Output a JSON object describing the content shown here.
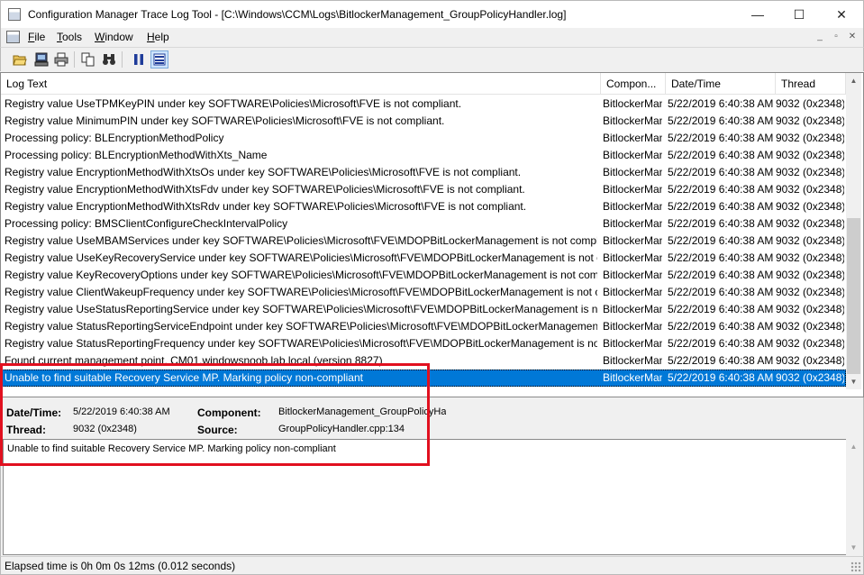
{
  "window": {
    "title": "Configuration Manager Trace Log Tool - [C:\\Windows\\CCM\\Logs\\BitlockerManagement_GroupPolicyHandler.log]",
    "controls": {
      "minimize": "—",
      "maximize": "☐",
      "close": "✕"
    }
  },
  "menu": {
    "items": [
      {
        "label": "File",
        "accel": "F",
        "rest": "ile"
      },
      {
        "label": "Tools",
        "accel": "T",
        "rest": "ools"
      },
      {
        "label": "Window",
        "accel": "W",
        "rest": "indow"
      },
      {
        "label": "Help",
        "accel": "H",
        "rest": "elp"
      }
    ],
    "mdi": {
      "minimize": "_",
      "restore": "▫",
      "close": "✕"
    }
  },
  "toolbar": {
    "buttons": [
      "open-icon",
      "open-remote-icon",
      "print-icon",
      "copy-icon",
      "find-icon",
      "pause-icon",
      "highlight-icon"
    ]
  },
  "log": {
    "columns": [
      "Log Text",
      "Compon...",
      "Date/Time",
      "Thread"
    ],
    "rows": [
      {
        "text": "Registry value UseTPMKeyPIN under key SOFTWARE\\Policies\\Microsoft\\FVE is not compliant.",
        "component": "BitlockerMan",
        "datetime": "5/22/2019 6:40:38 AM",
        "thread": "9032 (0x2348)"
      },
      {
        "text": "Registry value MinimumPIN under key SOFTWARE\\Policies\\Microsoft\\FVE is not compliant.",
        "component": "BitlockerMan",
        "datetime": "5/22/2019 6:40:38 AM",
        "thread": "9032 (0x2348)"
      },
      {
        "text": "Processing policy: BLEncryptionMethodPolicy",
        "component": "BitlockerMan",
        "datetime": "5/22/2019 6:40:38 AM",
        "thread": "9032 (0x2348)"
      },
      {
        "text": "Processing policy: BLEncryptionMethodWithXts_Name",
        "component": "BitlockerMan",
        "datetime": "5/22/2019 6:40:38 AM",
        "thread": "9032 (0x2348)"
      },
      {
        "text": "Registry value EncryptionMethodWithXtsOs under key SOFTWARE\\Policies\\Microsoft\\FVE is not compliant.",
        "component": "BitlockerMan",
        "datetime": "5/22/2019 6:40:38 AM",
        "thread": "9032 (0x2348)"
      },
      {
        "text": "Registry value EncryptionMethodWithXtsFdv under key SOFTWARE\\Policies\\Microsoft\\FVE is not compliant.",
        "component": "BitlockerMan",
        "datetime": "5/22/2019 6:40:38 AM",
        "thread": "9032 (0x2348)"
      },
      {
        "text": "Registry value EncryptionMethodWithXtsRdv under key SOFTWARE\\Policies\\Microsoft\\FVE is not compliant.",
        "component": "BitlockerMan",
        "datetime": "5/22/2019 6:40:38 AM",
        "thread": "9032 (0x2348)"
      },
      {
        "text": "Processing policy: BMSClientConfigureCheckIntervalPolicy",
        "component": "BitlockerMan",
        "datetime": "5/22/2019 6:40:38 AM",
        "thread": "9032 (0x2348)"
      },
      {
        "text": "Registry value UseMBAMServices under key SOFTWARE\\Policies\\Microsoft\\FVE\\MDOPBitLockerManagement is not compli...",
        "component": "BitlockerMan",
        "datetime": "5/22/2019 6:40:38 AM",
        "thread": "9032 (0x2348)"
      },
      {
        "text": "Registry value UseKeyRecoveryService under key SOFTWARE\\Policies\\Microsoft\\FVE\\MDOPBitLockerManagement is not c...",
        "component": "BitlockerMan",
        "datetime": "5/22/2019 6:40:38 AM",
        "thread": "9032 (0x2348)"
      },
      {
        "text": "Registry value KeyRecoveryOptions under key SOFTWARE\\Policies\\Microsoft\\FVE\\MDOPBitLockerManagement is not com...",
        "component": "BitlockerMan",
        "datetime": "5/22/2019 6:40:38 AM",
        "thread": "9032 (0x2348)"
      },
      {
        "text": "Registry value ClientWakeupFrequency under key SOFTWARE\\Policies\\Microsoft\\FVE\\MDOPBitLockerManagement is not c...",
        "component": "BitlockerMan",
        "datetime": "5/22/2019 6:40:38 AM",
        "thread": "9032 (0x2348)"
      },
      {
        "text": "Registry value UseStatusReportingService under key SOFTWARE\\Policies\\Microsoft\\FVE\\MDOPBitLockerManagement is no...",
        "component": "BitlockerMan",
        "datetime": "5/22/2019 6:40:38 AM",
        "thread": "9032 (0x2348)"
      },
      {
        "text": "Registry value StatusReportingServiceEndpoint under key SOFTWARE\\Policies\\Microsoft\\FVE\\MDOPBitLockerManagement...",
        "component": "BitlockerMan",
        "datetime": "5/22/2019 6:40:38 AM",
        "thread": "9032 (0x2348)"
      },
      {
        "text": "Registry value StatusReportingFrequency under key SOFTWARE\\Policies\\Microsoft\\FVE\\MDOPBitLockerManagement is no...",
        "component": "BitlockerMan",
        "datetime": "5/22/2019 6:40:38 AM",
        "thread": "9032 (0x2348)"
      },
      {
        "text": "Found current management point, CM01.windowsnoob.lab.local (version 8827)",
        "component": "BitlockerMan",
        "datetime": "5/22/2019 6:40:38 AM",
        "thread": "9032 (0x2348)"
      },
      {
        "text": "Unable to find suitable Recovery Service MP. Marking policy non-compliant",
        "component": "BitlockerMan",
        "datetime": "5/22/2019 6:40:38 AM",
        "thread": "9032 (0x2348)",
        "selected": true
      }
    ]
  },
  "details": {
    "datetime_label": "Date/Time:",
    "datetime_value": "5/22/2019 6:40:38 AM",
    "component_label": "Component:",
    "component_value": "BitlockerManagement_GroupPolicyHand",
    "thread_label": "Thread:",
    "thread_value": "9032 (0x2348)",
    "source_label": "Source:",
    "source_value": "GroupPolicyHandler.cpp:134",
    "message": "Unable to find suitable Recovery Service MP. Marking policy non-compliant"
  },
  "status": {
    "text": "Elapsed time is 0h 0m 0s 12ms (0.012 seconds)"
  },
  "colors": {
    "selection": "#0078d7",
    "annotation_box": "#e1101f"
  }
}
